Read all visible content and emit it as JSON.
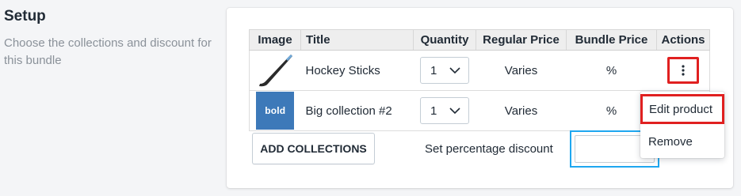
{
  "setup": {
    "title": "Setup",
    "description": "Choose the collections and discount for this bundle"
  },
  "table": {
    "headers": {
      "image": "Image",
      "title": "Title",
      "quantity": "Quantity",
      "regular_price": "Regular Price",
      "bundle_price": "Bundle Price",
      "actions": "Actions"
    },
    "rows": [
      {
        "image_icon": "hockey-stick-image",
        "title": "Hockey Sticks",
        "quantity": "1",
        "regular_price": "Varies",
        "bundle_price": "%"
      },
      {
        "image_icon": "bold-logo-image",
        "image_text": "bold",
        "title": "Big collection #2",
        "quantity": "1",
        "regular_price": "Varies",
        "bundle_price": "%"
      }
    ]
  },
  "footer": {
    "add_collections_label": "ADD COLLECTIONS",
    "discount_label": "Set percentage discount",
    "discount_value": ""
  },
  "actions_menu": {
    "items": [
      "Edit product",
      "Remove"
    ]
  },
  "colors": {
    "highlight": "#e02020",
    "focus": "#1ea7f0",
    "bold_logo_bg": "#3d79b9"
  }
}
